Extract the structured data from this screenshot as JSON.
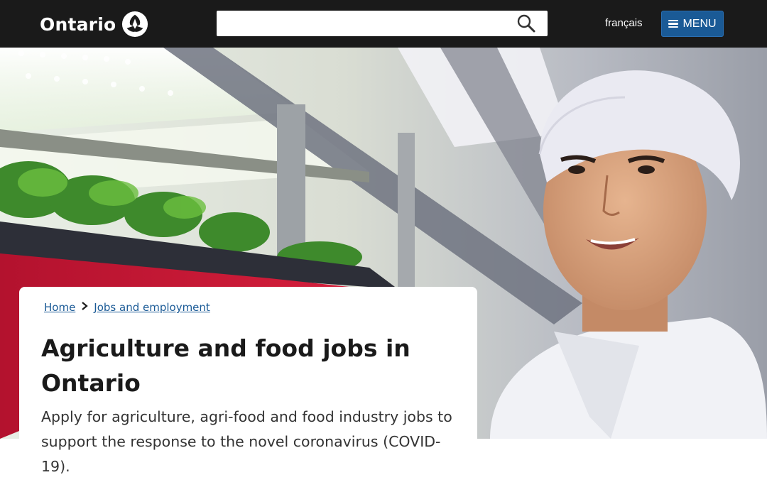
{
  "header": {
    "logo_text": "Ontario",
    "logo_icon": "ontario-trillium-icon",
    "search": {
      "placeholder": "",
      "value": "",
      "icon": "search-icon"
    },
    "language_link": "français",
    "menu_label": "MENU",
    "menu_icon": "hamburger-icon"
  },
  "colors": {
    "header_bg": "#1a1a1a",
    "menu_button": "#1a5a96",
    "link": "#1a5a96",
    "accent_red": "#c8102e"
  },
  "breadcrumb": {
    "home": "Home",
    "separator_icon": "chevron-right-icon",
    "current": "Jobs and employment"
  },
  "main": {
    "title": "Agriculture and food jobs in Ontario",
    "lead": "Apply for agriculture, agri-food and food industry jobs to support the response to the novel coronavirus (COVID-19)."
  }
}
